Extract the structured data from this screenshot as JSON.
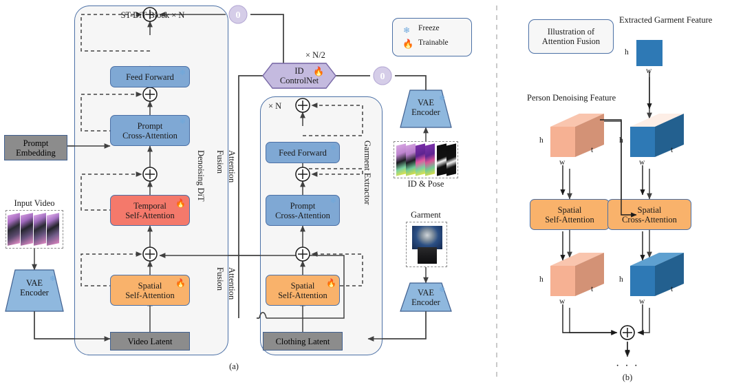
{
  "figure": {
    "panel_a_caption": "(a)",
    "panel_b_caption": "(b)",
    "ellipsis": "· · ·"
  },
  "legend": {
    "freeze_label": "Freeze",
    "trainable_label": "Trainable",
    "freeze_icon": "snowflake-icon",
    "trainable_icon": "flame-icon"
  },
  "panel_a": {
    "stdit_block": {
      "title": "ST-DiT Block × N",
      "side_label": "Denoising DiT",
      "blocks": [
        {
          "label_line1": "Feed Forward",
          "label_line2": "",
          "state": "freeze"
        },
        {
          "label_line1": "Prompt",
          "label_line2": "Cross-Attention",
          "state": "freeze"
        },
        {
          "label_line1": "Temporal",
          "label_line2": "Self-Attention",
          "state": "trainable"
        },
        {
          "label_line1": "Spatial",
          "label_line2": "Self-Attention",
          "state": "trainable"
        }
      ],
      "latent_label": "Video Latent"
    },
    "garment_extractor": {
      "repeat_label": "× N",
      "side_label": "Garment Extractor",
      "blocks": [
        {
          "label_line1": "Feed Forward",
          "label_line2": "",
          "state": "freeze"
        },
        {
          "label_line1": "Prompt",
          "label_line2": "Cross-Attention",
          "state": "freeze"
        },
        {
          "label_line1": "Spatial",
          "label_line2": "Self-Attention",
          "state": "trainable"
        }
      ],
      "latent_label": "Clothing Latent"
    },
    "id_controlnet": {
      "label_line1": "ID",
      "label_line2": "ControlNet",
      "repeat_label": "× N/2",
      "state": "trainable"
    },
    "zero_conv_left": "0",
    "zero_conv_right": "0",
    "prompt_embedding": "Prompt\nEmbedding",
    "prompt_embedding_line1": "Prompt",
    "prompt_embedding_line2": "Embedding",
    "input_video_label": "Input Video",
    "id_pose_label": "ID & Pose",
    "garment_label": "Garment",
    "vae_encoders": [
      {
        "line1": "VAE",
        "line2": "Encoder",
        "state": "freeze"
      },
      {
        "line1": "VAE",
        "line2": "Encoder",
        "state": "freeze"
      },
      {
        "line1": "VAE",
        "line2": "Encoder",
        "state": "freeze"
      }
    ],
    "fusion_labels": {
      "upper_fusion": "Fusion",
      "upper_attention": "Attention",
      "lower_fusion": "Fusion",
      "lower_attention": "Attention"
    }
  },
  "panel_b": {
    "title_line1": "Illustration of",
    "title_line2": "Attention Fusion",
    "garment_feature_title": "Extracted Garment Feature",
    "person_feature_title": "Person Denoising Feature",
    "self_attention_line1": "Spatial",
    "self_attention_line2": "Self-Attention",
    "cross_attention_line1": "Spatial",
    "cross_attention_line2": "Cross-Attention",
    "dims": {
      "h": "h",
      "w": "w",
      "t": "t"
    },
    "plus": "+"
  },
  "colors": {
    "blue_block": "#7FA8D4",
    "orange_block": "#F9B26B",
    "red_block": "#F4796B",
    "grey_block": "#8C8C8C",
    "purple_block": "#C4BADF",
    "panel_border": "#4A6FA5",
    "panel_fill": "#F6F6F6",
    "arrow": "#404040",
    "person_cube": "#F3AD90",
    "garment_cube": "#2E79B5",
    "zero_circle": "#D5CDE8"
  }
}
